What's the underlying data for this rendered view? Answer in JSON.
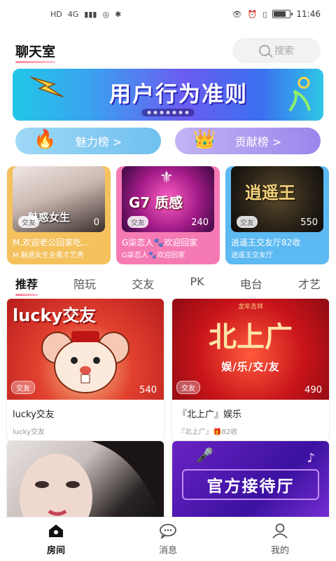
{
  "status_bar": {
    "left_icons": [
      "HD",
      "4G",
      "signal",
      "wechat",
      "notify"
    ],
    "time": "11:46"
  },
  "header": {
    "title": "聊天室",
    "search_placeholder": "搜索"
  },
  "banner": {
    "text": "用户行为准则"
  },
  "rank_buttons": [
    {
      "label": "魅力榜 >",
      "emblem": "🔥"
    },
    {
      "label": "贡献榜 >",
      "emblem": "👑"
    }
  ],
  "featured_rooms": [
    {
      "title": "M.欢迎老公回家吃...",
      "subtitle": "M.魅惑女生全麦才艺秀",
      "tag": "交友",
      "hot": "0",
      "art_text": "魅惑女生"
    },
    {
      "title": "G柒恋人🐾欢迎回家",
      "subtitle": "G柒恋人🐾欢迎回家",
      "tag": "交友",
      "hot": "240",
      "art_text": "G7 质感"
    },
    {
      "title": "逍遥王交友厅82收",
      "subtitle": "逍遥王交友厅",
      "tag": "交友",
      "hot": "550",
      "art_text": "逍遥王"
    }
  ],
  "tabs": [
    "推荐",
    "陪玩",
    "交友",
    "PK",
    "电台",
    "才艺"
  ],
  "rooms": [
    {
      "title": "lucky交友",
      "subtitle": "lucky交友",
      "tag": "交友",
      "hot": "540",
      "art_text": "lucky交友"
    },
    {
      "title": "『北上广』娱乐",
      "subtitle": "『北上广』🎁82收",
      "tag": "交友",
      "hot": "490",
      "art_small": "龙年吉祥",
      "art_big": "北上广",
      "art_sub": "娱/乐/交/友"
    },
    {
      "title": "",
      "subtitle": "",
      "tag": "",
      "hot": ""
    },
    {
      "title": "",
      "subtitle": "",
      "tag": "",
      "hot": "",
      "art_text": "官方接待厅"
    }
  ],
  "bottom_nav": [
    {
      "label": "房间",
      "icon": "home-icon",
      "active": true
    },
    {
      "label": "消息",
      "icon": "message-icon",
      "active": false
    },
    {
      "label": "我的",
      "icon": "profile-icon",
      "active": false
    }
  ]
}
